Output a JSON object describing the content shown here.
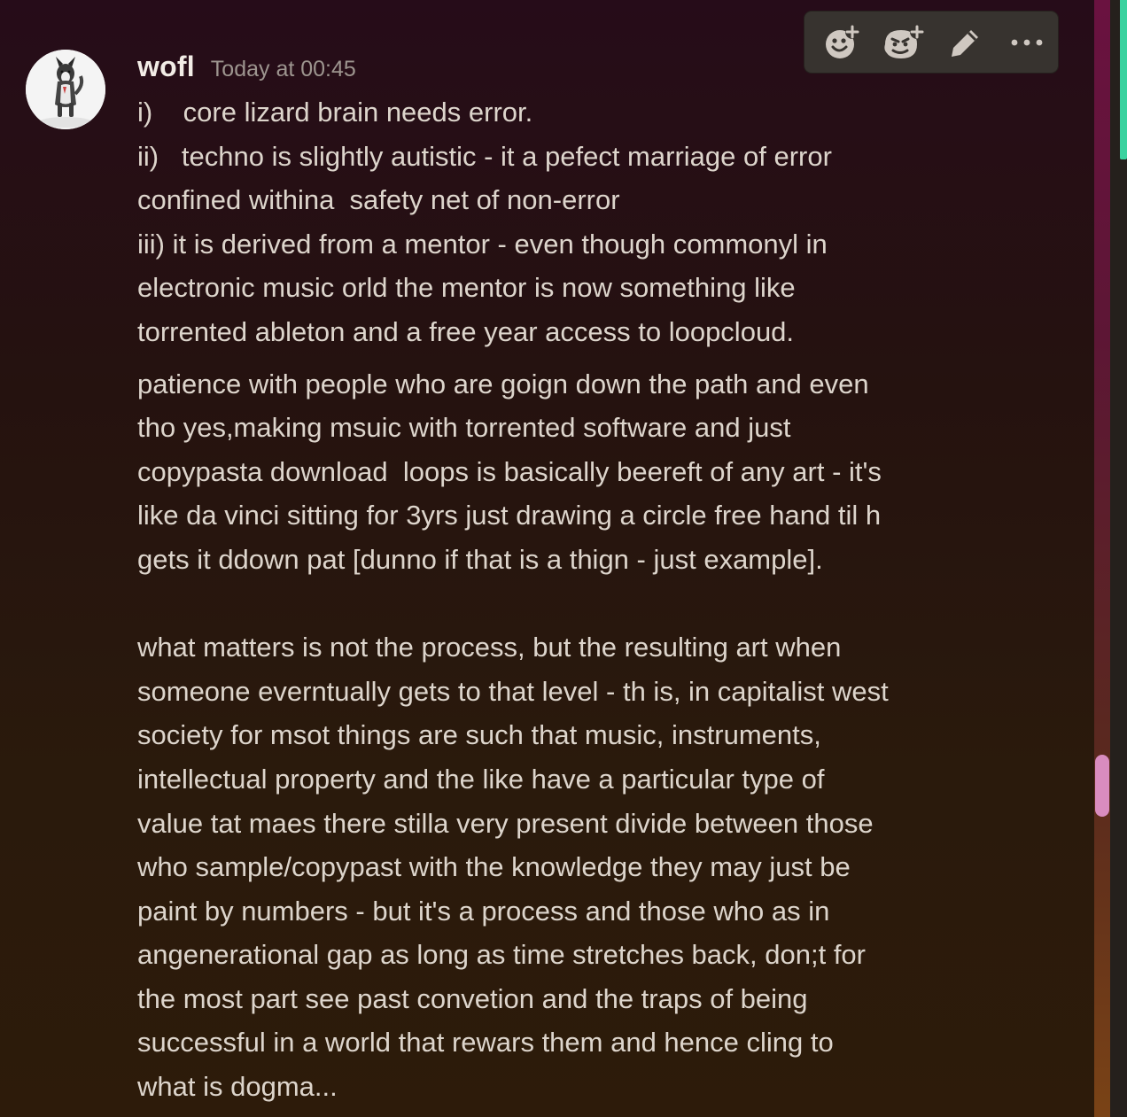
{
  "message": {
    "username": "wofl",
    "timestamp": "Today at 00:45",
    "lines1": [
      "i)    core lizard brain needs error.",
      "ii)   techno is slightly autistic - it a pefect marriage of error",
      "confined withina  safety net of non-error",
      "iii) it is derived from a mentor - even though commonyl in",
      "electronic music orld the mentor is now something like",
      "torrented ableton and a free year access to loopcloud."
    ],
    "lines2": [
      "patience with people who are goign down the path and even",
      "tho yes,making msuic with torrented software and just",
      "copypasta download  loops is basically beereft of any art - it's",
      "like da vinci sitting for 3yrs just drawing a circle free hand til h",
      "gets it ddown pat [dunno if that is a thign - just example]."
    ],
    "lines3": [
      "what matters is not the process, but the resulting art when",
      "someone everntually gets to that level - th is, in capitalist west",
      "society for msot things are such that music, instruments,",
      "intellectual property and the like have a particular type of",
      "value tat maes there stilla very present divide between those",
      "who sample/copypast with the knowledge they may just be",
      "paint by numbers - but it's a process and those who as in",
      "angenerational gap as long as time stretches back, don;t for",
      "the most part see past convetion and the traps of being",
      "successful in a world that rewars them and hence cling to",
      "what is dogma..."
    ]
  },
  "toolbar": {
    "icons": [
      "add-reaction-icon",
      "add-super-reaction-icon",
      "edit-icon",
      "more-options-icon"
    ]
  },
  "colors": {
    "accent_scroll": "#d98cbf",
    "rail_green": "#3ad29f"
  }
}
